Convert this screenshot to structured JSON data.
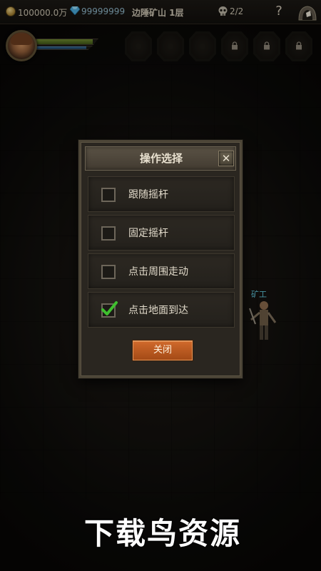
{
  "hud": {
    "gold": "100000.0万",
    "gems": "99999999",
    "map_name": "边陲矿山 1层",
    "kills": "2/2",
    "help_label": "?",
    "coin_icon": "gold-coin-icon",
    "gem_icon": "diamond-icon",
    "skull_icon": "skull-icon",
    "exit_icon": "exit-door-icon"
  },
  "player": {
    "hp_fraction": 0.92,
    "mp_fraction": 0.9
  },
  "skills": {
    "slots": [
      {
        "state": "empty"
      },
      {
        "state": "empty"
      },
      {
        "state": "empty"
      },
      {
        "state": "locked"
      },
      {
        "state": "locked"
      },
      {
        "state": "locked"
      }
    ]
  },
  "npc": {
    "name": "矿工"
  },
  "dialog": {
    "title": "操作选择",
    "close_x": "✕",
    "options": [
      {
        "label": "跟随摇杆",
        "checked": false
      },
      {
        "label": "固定摇杆",
        "checked": false
      },
      {
        "label": "点击周围走动",
        "checked": false
      },
      {
        "label": "点击地面到达",
        "checked": true
      }
    ],
    "close_button": "关闭"
  },
  "watermark": "下载鸟资源",
  "colors": {
    "accent_orange": "#c25c22",
    "check_green": "#3fbf2f",
    "npc_name": "#5fc4d8",
    "hp_green": "#6f8a2f"
  }
}
